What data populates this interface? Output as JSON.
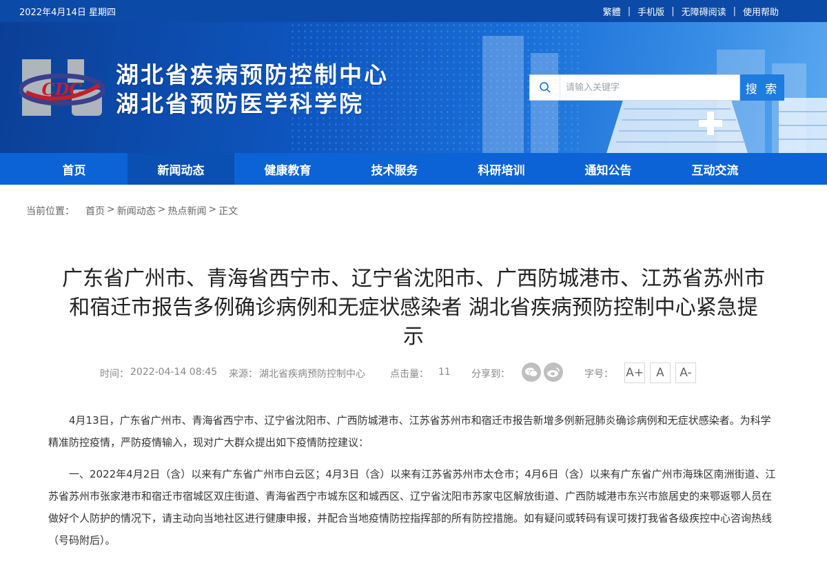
{
  "topbar": {
    "date": "2022年4月14日 星期四",
    "links": [
      "繁體",
      "手机版",
      "无障碍阅读",
      "使用帮助"
    ]
  },
  "header": {
    "logo_text": "CDC",
    "title_line1": "湖北省疾病预防控制中心",
    "title_line2": "湖北省预防医学科学院"
  },
  "search": {
    "placeholder": "请输入关键字",
    "button": "搜 索",
    "icon": "search-icon"
  },
  "nav": {
    "items": [
      "首页",
      "新闻动态",
      "健康教育",
      "技术服务",
      "科研培训",
      "通知公告",
      "互动交流"
    ],
    "active_index": 1
  },
  "breadcrumb": {
    "label": "当前位置：",
    "items": [
      "首页",
      "新闻动态",
      "热点新闻",
      "正文"
    ],
    "separator": ">"
  },
  "article": {
    "title_line1": "广东省广州市、青海省西宁市、辽宁省沈阳市、广西防城港市、江苏省苏州市",
    "title_line2": "和宿迁市报告多例确诊病例和无症状感染者 湖北省疾病预防控制中心紧急提",
    "title_line3": "示",
    "meta": {
      "time_label": "时间：",
      "time": "2022-04-14 08:45",
      "source_label": "来源：",
      "source": "湖北省疾病预防控制中心",
      "clicks_label": "点击量：",
      "clicks": "11",
      "share_label": "分享到：",
      "share_icons": [
        "wechat-icon",
        "weibo-icon"
      ],
      "fontsize_label": "字号：",
      "fontsize_buttons": [
        "A+",
        "A",
        "A-"
      ]
    },
    "paragraphs": [
      "4月13日，广东省广州市、青海省西宁市、辽宁省沈阳市、广西防城港市、江苏省苏州市和宿迁市报告新增多例新冠肺炎确诊病例和无症状感染者。为科学精准防控疫情，严防疫情输入，现对广大群众提出如下疫情防控建议：",
      "一、2022年4月2日（含）以来有广东省广州市白云区；4月3日（含）以来有江苏省苏州市太仓市；4月6日（含）以来有广东省广州市海珠区南洲街道、江苏省苏州市张家港市和宿迁市宿城区双庄街道、青海省西宁市城东区和城西区、辽宁省沈阳市苏家屯区解放街道、广西防城港市东兴市旅居史的来鄂返鄂人员在做好个人防护的情况下，请主动向当地社区进行健康申报，并配合当地疫情防控指挥部的所有防控措施。如有疑问或转码有误可拨打我省各级疾控中心咨询热线（号码附后）。"
    ]
  },
  "colors": {
    "topbar": "#0c4aa7",
    "nav": "#0b63d6",
    "nav_active": "#0a4fb2",
    "search_button": "#1e7be0"
  }
}
